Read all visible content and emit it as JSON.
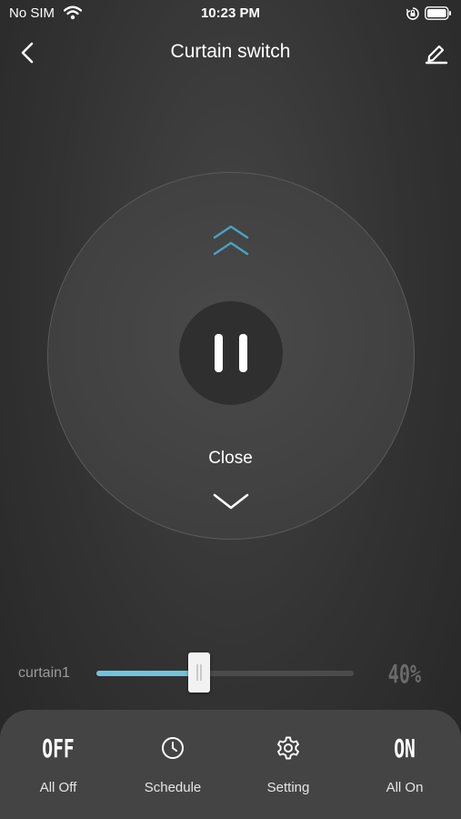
{
  "status_bar": {
    "carrier": "No SIM",
    "time": "10:23 PM",
    "icons": [
      "wifi-icon",
      "orientation-lock-icon",
      "battery-icon"
    ]
  },
  "header": {
    "title": "Curtain switch",
    "back_icon": "chevron-left-icon",
    "edit_icon": "pencil-icon"
  },
  "control": {
    "open_icon": "double-chevron-up-icon",
    "pause_icon": "pause-icon",
    "close_label": "Close",
    "close_icon": "chevron-down-icon"
  },
  "slider": {
    "label": "curtain1",
    "value_text": "40%",
    "value": 0.4
  },
  "bottom_bar": {
    "items": [
      {
        "glyph": "OFF",
        "label": "All Off"
      },
      {
        "icon": "clock-icon",
        "label": "Schedule"
      },
      {
        "icon": "gear-icon",
        "label": "Setting"
      },
      {
        "glyph": "ON",
        "label": "All On"
      }
    ]
  },
  "colors": {
    "accent": "#6fc4dc",
    "background": "#323232",
    "sheet": "#444444"
  }
}
